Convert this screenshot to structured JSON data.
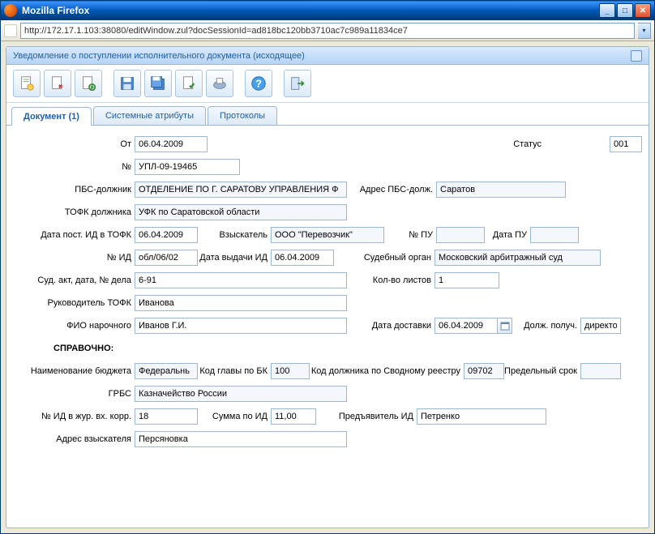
{
  "window": {
    "title": "Mozilla Firefox"
  },
  "url": "http://172.17.1.103:38080/editWindow.zul?docSessionId=ad818bc120bb3710ac7c989a11834ce7",
  "panel": {
    "title": "Уведомление о поступлении исполнительного документа (исходящее)"
  },
  "tabs": {
    "t1": "Документ (1)",
    "t2": "Системные атрибуты",
    "t3": "Протоколы"
  },
  "labels": {
    "ot": "От",
    "status": "Статус",
    "no": "№",
    "pbs": "ПБС-должник",
    "adr_pbs": "Адрес ПБС-долж.",
    "tofk": "ТОФК должника",
    "data_post": "Дата пост. ИД в ТОФК",
    "vzysk": "Взыскатель",
    "no_pu": "№ ПУ",
    "data_pu": "Дата ПУ",
    "no_id": "№ ИД",
    "data_vyd": "Дата выдачи ИД",
    "sud": "Судебный орган",
    "sud_akt": "Суд. акт, дата, № дела",
    "kol_list": "Кол-во листов",
    "ruk": "Руководитель ТОФК",
    "fio": "ФИО нарочного",
    "data_dost": "Дата доставки",
    "dolz": "Долж. получ.",
    "sprav": "СПРАВОЧНО:",
    "naim": "Наименование бюджета",
    "kod_gl": "Код главы по БК",
    "kod_dolz": "Код должника по Сводному реестру",
    "pred_srok": "Предельный срок",
    "grbs": "ГРБС",
    "no_id_zhur": "№ ИД в жур. вх. корр.",
    "summa": "Сумма по ИД",
    "pred_id": "Предъявитель ИД",
    "adr_vz": "Адрес взыскателя"
  },
  "values": {
    "ot": "06.04.2009",
    "status": "001",
    "no": "УПЛ-09-19465",
    "pbs": "ОТДЕЛЕНИЕ ПО Г. САРАТОВУ УПРАВЛЕНИЯ Ф",
    "adr_pbs": "Саратов",
    "tofk": "УФК по Саратовской области",
    "data_post": "06.04.2009",
    "vzysk": "ООО \"Перевозчик\"",
    "no_pu": "",
    "data_pu": "",
    "no_id": "обл/06/02",
    "data_vyd": "06.04.2009",
    "sud": "Московский арбитражный суд",
    "sud_akt": "6-91",
    "kol_list": "1",
    "ruk": "Иванова",
    "fio": "Иванов Г.И.",
    "data_dost": "06.04.2009",
    "dolz": "директор",
    "naim": "Федеральнь",
    "kod_gl": "100",
    "kod_dolz": "09702",
    "pred_srok": "",
    "grbs": "Казначейство России",
    "no_id_zhur": "18",
    "summa": "11,00",
    "pred_id": "Петренко",
    "adr_vz": "Персяновка"
  }
}
